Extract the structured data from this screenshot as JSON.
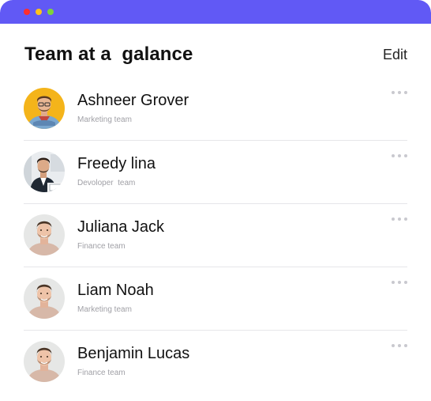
{
  "window": {
    "accent_color": "#6159f5",
    "controls": [
      "close",
      "minimize",
      "maximize"
    ]
  },
  "header": {
    "title": "Team at a  galance",
    "edit_label": "Edit"
  },
  "members": [
    {
      "name": "Ashneer Grover",
      "team": "Marketing team",
      "avatar": "man-yellow-background"
    },
    {
      "name": "Freedy lina",
      "team": "Devoloper  team",
      "avatar": "man-at-desk"
    },
    {
      "name": "Juliana Jack",
      "team": "Finance team",
      "avatar": "smiling-man"
    },
    {
      "name": "Liam Noah",
      "team": "Marketing team",
      "avatar": "smiling-man"
    },
    {
      "name": "Benjamin Lucas",
      "team": "Finance team",
      "avatar": "smiling-man"
    }
  ],
  "more_icon": "more-horizontal-icon"
}
